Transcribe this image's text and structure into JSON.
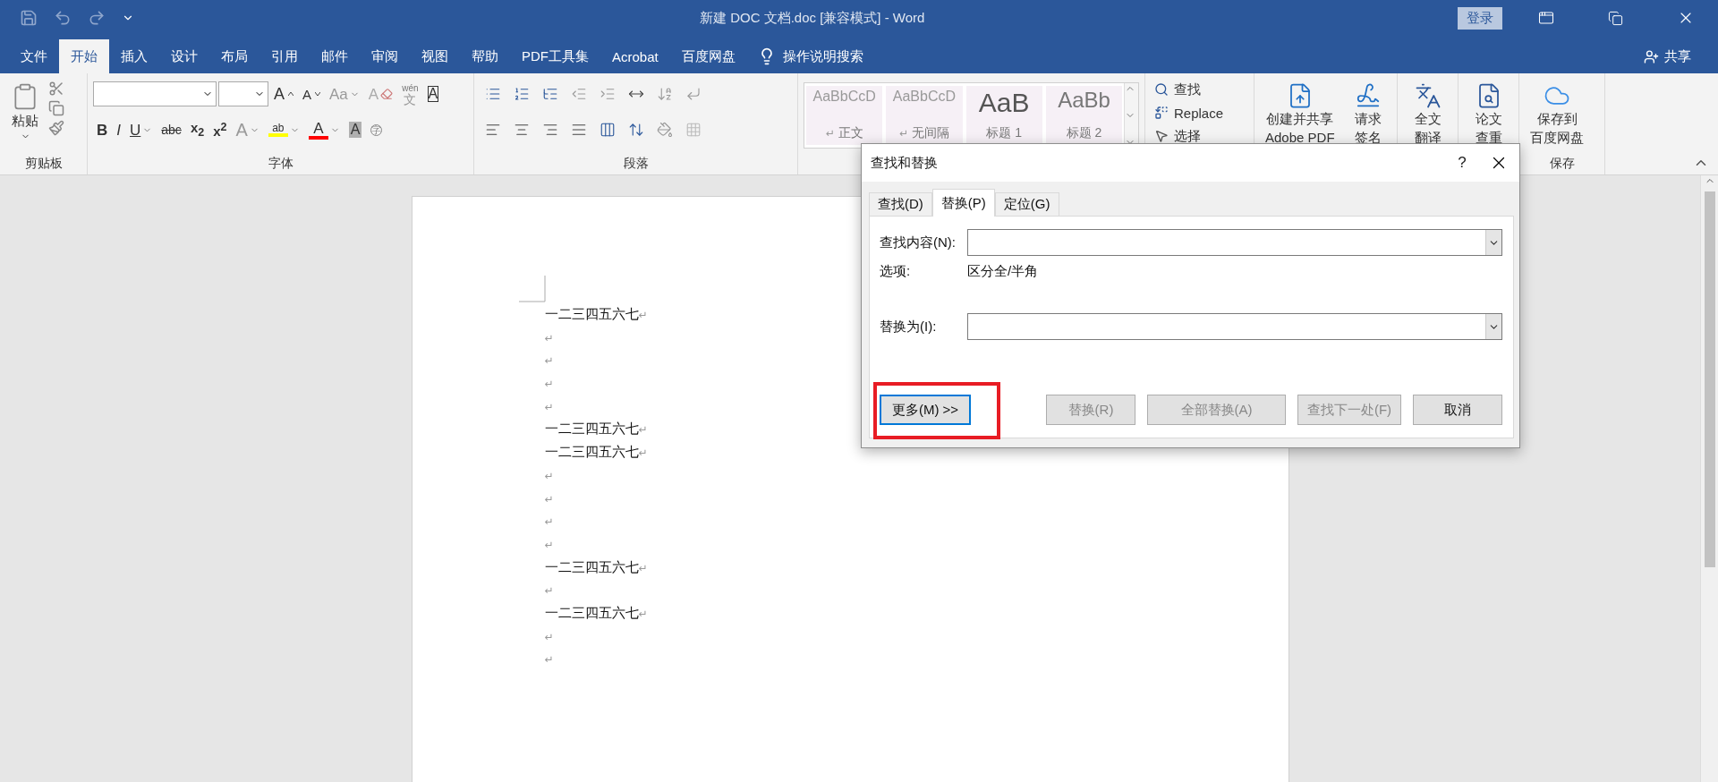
{
  "title_bar": {
    "title": "新建 DOC 文档.doc [兼容模式]  -  Word",
    "sign_in": "登录"
  },
  "ribbon_tabs": [
    {
      "label": "文件",
      "selected": false
    },
    {
      "label": "开始",
      "selected": true
    },
    {
      "label": "插入",
      "selected": false
    },
    {
      "label": "设计",
      "selected": false
    },
    {
      "label": "布局",
      "selected": false
    },
    {
      "label": "引用",
      "selected": false
    },
    {
      "label": "邮件",
      "selected": false
    },
    {
      "label": "审阅",
      "selected": false
    },
    {
      "label": "视图",
      "selected": false
    },
    {
      "label": "帮助",
      "selected": false
    },
    {
      "label": "PDF工具集",
      "selected": false
    },
    {
      "label": "Acrobat",
      "selected": false
    },
    {
      "label": "百度网盘",
      "selected": false
    }
  ],
  "tell_me": "操作说明搜索",
  "share": "共享",
  "ribbon": {
    "clipboard": {
      "paste": "粘贴",
      "label": "剪贴板"
    },
    "font": {
      "label": "字体",
      "row1": [
        {
          "kind": "grow",
          "glyph": "A"
        },
        {
          "kind": "shrink",
          "glyph": "A"
        },
        {
          "kind": "case",
          "glyph": "Aa"
        },
        {
          "kind": "clear",
          "glyph": "A"
        },
        {
          "kind": "phonetic",
          "glyph": "文",
          "ruby": "wén"
        },
        {
          "kind": "boxed",
          "glyph": "A"
        }
      ],
      "row2": [
        {
          "kind": "bold",
          "glyph": "B"
        },
        {
          "kind": "italic",
          "glyph": "I"
        },
        {
          "kind": "underline",
          "glyph": "U"
        },
        {
          "kind": "strike",
          "glyph": "abc"
        },
        {
          "kind": "script",
          "glyph": "x$_{2}$"
        },
        {
          "kind": "script",
          "glyph": "x$^{2}$"
        },
        {
          "kind": "effects",
          "glyph": "A"
        },
        {
          "kind": "highlight",
          "glyph": "ab",
          "color": "#ffff00"
        },
        {
          "kind": "color",
          "glyph": "A",
          "color": "#ff0000"
        },
        {
          "kind": "shaded",
          "glyph": "A"
        },
        {
          "kind": "circled",
          "glyph": "字"
        }
      ]
    },
    "paragraph": {
      "label": "段落"
    },
    "styles": [
      {
        "kind": "body",
        "preview": "AaBbCcD",
        "mark": "↵",
        "name": "正文"
      },
      {
        "kind": "body",
        "preview": "AaBbCcD",
        "mark": "↵",
        "name": "无间隔"
      },
      {
        "kind": "heading1",
        "preview": "AaB",
        "name": "标题 1"
      },
      {
        "kind": "heading2",
        "preview": "AaBb",
        "name": "标题 2"
      }
    ],
    "editing": [
      {
        "kind": "find",
        "label": "查找"
      },
      {
        "kind": "replace",
        "label": "Replace"
      },
      {
        "kind": "select",
        "label": "选择"
      }
    ],
    "big_buttons": [
      {
        "kind": "pdf",
        "lines": [
          "创建并共享",
          "Adobe PDF"
        ]
      },
      {
        "kind": "sign",
        "lines": [
          "请求",
          "签名"
        ]
      },
      {
        "kind": "translate",
        "lines": [
          "全文",
          "翻译"
        ]
      },
      {
        "kind": "check",
        "lines": [
          "论文",
          "查重"
        ]
      },
      {
        "kind": "cloud",
        "lines": [
          "保存到",
          "百度网盘"
        ],
        "group": "保存"
      }
    ]
  },
  "document": {
    "paragraphs": [
      {
        "text": "一二三四五六七",
        "mark": "↵"
      },
      {
        "mark": "↵"
      },
      {
        "mark": "↵"
      },
      {
        "mark": "↵"
      },
      {
        "mark": "↵"
      },
      {
        "text": "一二三四五六七",
        "mark": "↵"
      },
      {
        "text": "一二三四五六七",
        "mark": "↵"
      },
      {
        "mark": "↵"
      },
      {
        "mark": "↵"
      },
      {
        "mark": "↵"
      },
      {
        "mark": "↵"
      },
      {
        "text": "一二三四五六七",
        "mark": "↵"
      },
      {
        "mark": "↵"
      },
      {
        "text": "一二三四五六七",
        "mark": "↵"
      },
      {
        "mark": "↵"
      },
      {
        "mark": "↵"
      }
    ]
  },
  "dialog": {
    "title": "查找和替换",
    "help": "?",
    "tabs": [
      {
        "label": "查找(D)",
        "selected": false
      },
      {
        "label": "替换(P)",
        "selected": true
      },
      {
        "label": "定位(G)",
        "selected": false
      }
    ],
    "find_label": "查找内容(N):",
    "options_label": "选项:",
    "options_value": "区分全/半角",
    "replace_label": "替换为(I):",
    "more_button": {
      "label": "更多(M) >>",
      "highlighted": true
    },
    "buttons": [
      {
        "label": "替换(R)",
        "disabled": true
      },
      {
        "label": "全部替换(A)",
        "disabled": true
      },
      {
        "label": "查找下一处(F)",
        "disabled": true
      },
      {
        "label": "取消",
        "disabled": false
      }
    ]
  }
}
